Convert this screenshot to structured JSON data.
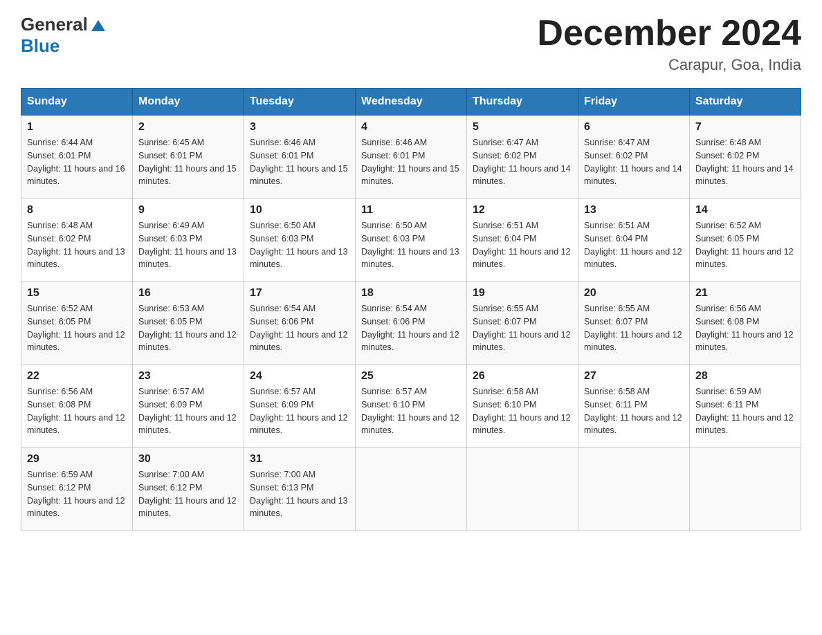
{
  "header": {
    "logo_general": "General",
    "logo_blue": "Blue",
    "month_title": "December 2024",
    "location": "Carapur, Goa, India"
  },
  "days_of_week": [
    "Sunday",
    "Monday",
    "Tuesday",
    "Wednesday",
    "Thursday",
    "Friday",
    "Saturday"
  ],
  "weeks": [
    [
      {
        "day": "1",
        "sunrise": "6:44 AM",
        "sunset": "6:01 PM",
        "daylight": "11 hours and 16 minutes."
      },
      {
        "day": "2",
        "sunrise": "6:45 AM",
        "sunset": "6:01 PM",
        "daylight": "11 hours and 15 minutes."
      },
      {
        "day": "3",
        "sunrise": "6:46 AM",
        "sunset": "6:01 PM",
        "daylight": "11 hours and 15 minutes."
      },
      {
        "day": "4",
        "sunrise": "6:46 AM",
        "sunset": "6:01 PM",
        "daylight": "11 hours and 15 minutes."
      },
      {
        "day": "5",
        "sunrise": "6:47 AM",
        "sunset": "6:02 PM",
        "daylight": "11 hours and 14 minutes."
      },
      {
        "day": "6",
        "sunrise": "6:47 AM",
        "sunset": "6:02 PM",
        "daylight": "11 hours and 14 minutes."
      },
      {
        "day": "7",
        "sunrise": "6:48 AM",
        "sunset": "6:02 PM",
        "daylight": "11 hours and 14 minutes."
      }
    ],
    [
      {
        "day": "8",
        "sunrise": "6:48 AM",
        "sunset": "6:02 PM",
        "daylight": "11 hours and 13 minutes."
      },
      {
        "day": "9",
        "sunrise": "6:49 AM",
        "sunset": "6:03 PM",
        "daylight": "11 hours and 13 minutes."
      },
      {
        "day": "10",
        "sunrise": "6:50 AM",
        "sunset": "6:03 PM",
        "daylight": "11 hours and 13 minutes."
      },
      {
        "day": "11",
        "sunrise": "6:50 AM",
        "sunset": "6:03 PM",
        "daylight": "11 hours and 13 minutes."
      },
      {
        "day": "12",
        "sunrise": "6:51 AM",
        "sunset": "6:04 PM",
        "daylight": "11 hours and 12 minutes."
      },
      {
        "day": "13",
        "sunrise": "6:51 AM",
        "sunset": "6:04 PM",
        "daylight": "11 hours and 12 minutes."
      },
      {
        "day": "14",
        "sunrise": "6:52 AM",
        "sunset": "6:05 PM",
        "daylight": "11 hours and 12 minutes."
      }
    ],
    [
      {
        "day": "15",
        "sunrise": "6:52 AM",
        "sunset": "6:05 PM",
        "daylight": "11 hours and 12 minutes."
      },
      {
        "day": "16",
        "sunrise": "6:53 AM",
        "sunset": "6:05 PM",
        "daylight": "11 hours and 12 minutes."
      },
      {
        "day": "17",
        "sunrise": "6:54 AM",
        "sunset": "6:06 PM",
        "daylight": "11 hours and 12 minutes."
      },
      {
        "day": "18",
        "sunrise": "6:54 AM",
        "sunset": "6:06 PM",
        "daylight": "11 hours and 12 minutes."
      },
      {
        "day": "19",
        "sunrise": "6:55 AM",
        "sunset": "6:07 PM",
        "daylight": "11 hours and 12 minutes."
      },
      {
        "day": "20",
        "sunrise": "6:55 AM",
        "sunset": "6:07 PM",
        "daylight": "11 hours and 12 minutes."
      },
      {
        "day": "21",
        "sunrise": "6:56 AM",
        "sunset": "6:08 PM",
        "daylight": "11 hours and 12 minutes."
      }
    ],
    [
      {
        "day": "22",
        "sunrise": "6:56 AM",
        "sunset": "6:08 PM",
        "daylight": "11 hours and 12 minutes."
      },
      {
        "day": "23",
        "sunrise": "6:57 AM",
        "sunset": "6:09 PM",
        "daylight": "11 hours and 12 minutes."
      },
      {
        "day": "24",
        "sunrise": "6:57 AM",
        "sunset": "6:09 PM",
        "daylight": "11 hours and 12 minutes."
      },
      {
        "day": "25",
        "sunrise": "6:57 AM",
        "sunset": "6:10 PM",
        "daylight": "11 hours and 12 minutes."
      },
      {
        "day": "26",
        "sunrise": "6:58 AM",
        "sunset": "6:10 PM",
        "daylight": "11 hours and 12 minutes."
      },
      {
        "day": "27",
        "sunrise": "6:58 AM",
        "sunset": "6:11 PM",
        "daylight": "11 hours and 12 minutes."
      },
      {
        "day": "28",
        "sunrise": "6:59 AM",
        "sunset": "6:11 PM",
        "daylight": "11 hours and 12 minutes."
      }
    ],
    [
      {
        "day": "29",
        "sunrise": "6:59 AM",
        "sunset": "6:12 PM",
        "daylight": "11 hours and 12 minutes."
      },
      {
        "day": "30",
        "sunrise": "7:00 AM",
        "sunset": "6:12 PM",
        "daylight": "11 hours and 12 minutes."
      },
      {
        "day": "31",
        "sunrise": "7:00 AM",
        "sunset": "6:13 PM",
        "daylight": "11 hours and 13 minutes."
      },
      null,
      null,
      null,
      null
    ]
  ],
  "labels": {
    "sunrise": "Sunrise:",
    "sunset": "Sunset:",
    "daylight": "Daylight:"
  }
}
